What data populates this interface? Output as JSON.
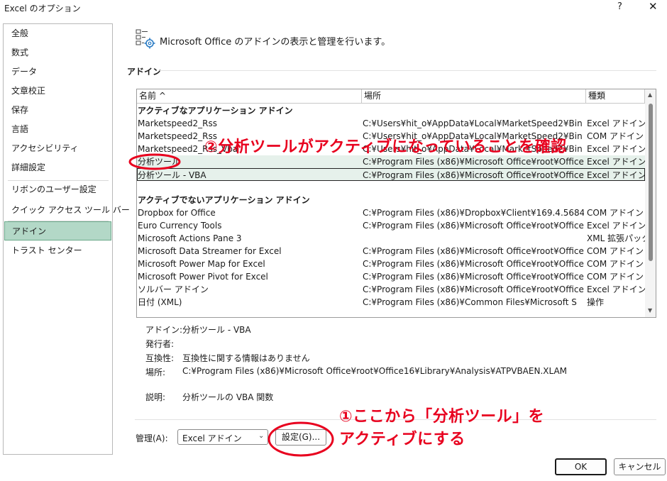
{
  "window": {
    "title": "Excel のオプション",
    "help": "?",
    "close": "✕"
  },
  "sidebar": {
    "items": [
      {
        "label": "全般"
      },
      {
        "label": "数式"
      },
      {
        "label": "データ"
      },
      {
        "label": "文章校正"
      },
      {
        "label": "保存"
      },
      {
        "label": "言語"
      },
      {
        "label": "アクセシビリティ"
      },
      {
        "label": "詳細設定"
      },
      {
        "label": "リボンのユーザー設定"
      },
      {
        "label": "クイック アクセス ツール バー"
      },
      {
        "label": "アドイン",
        "active": true
      },
      {
        "label": "トラスト センター"
      }
    ]
  },
  "header": {
    "text": "Microsoft Office のアドインの表示と管理を行います。",
    "icon": "addins-gear-icon"
  },
  "section": {
    "title": "アドイン"
  },
  "table": {
    "columns": [
      "名前 ^",
      "場所",
      "種類"
    ],
    "active_group": "アクティブなアプリケーション アドイン",
    "active_rows": [
      {
        "name": "Marketspeed2_Rss",
        "location": "C:¥Users¥hit_o¥AppData¥Local¥MarketSpeed2¥Bin",
        "type": "Excel アドイン"
      },
      {
        "name": "Marketspeed2_Rss",
        "location": "C:¥Users¥hit_o¥AppData¥Local¥MarketSpeed2¥Bin",
        "type": "COM アドイン"
      },
      {
        "name": "Marketspeed2_Rss_Vba",
        "location": "C:¥Users¥hit_o¥AppData¥Local¥MarketSpeed2¥Bin",
        "type": "Excel アドイン"
      },
      {
        "name": "分析ツール",
        "location": "C:¥Program Files (x86)¥Microsoft Office¥root¥Office",
        "type": "Excel アドイン"
      },
      {
        "name": "分析ツール - VBA",
        "location": "C:¥Program Files (x86)¥Microsoft Office¥root¥Office",
        "type": "Excel アドイン"
      }
    ],
    "inactive_group": "アクティブでないアプリケーション アドイン",
    "inactive_rows": [
      {
        "name": "Dropbox for Office",
        "location": "C:¥Program Files (x86)¥Dropbox¥Client¥169.4.5684",
        "type": "COM アドイン"
      },
      {
        "name": "Euro Currency Tools",
        "location": "C:¥Program Files (x86)¥Microsoft Office¥root¥Office",
        "type": "Excel アドイン"
      },
      {
        "name": "Microsoft Actions Pane 3",
        "location": "",
        "type": "XML 拡張パック"
      },
      {
        "name": "Microsoft Data Streamer for Excel",
        "location": "C:¥Program Files (x86)¥Microsoft Office¥root¥Office",
        "type": "COM アドイン"
      },
      {
        "name": "Microsoft Power Map for Excel",
        "location": "C:¥Program Files (x86)¥Microsoft Office¥root¥Office",
        "type": "COM アドイン"
      },
      {
        "name": "Microsoft Power Pivot for Excel",
        "location": "C:¥Program Files (x86)¥Microsoft Office¥root¥Office",
        "type": "COM アドイン"
      },
      {
        "name": "ソルバー アドイン",
        "location": "C:¥Program Files (x86)¥Microsoft Office¥root¥Office",
        "type": "Excel アドイン"
      },
      {
        "name": "日付 (XML)",
        "location": "C:¥Program Files (x86)¥Common Files¥Microsoft S",
        "type": "操作"
      }
    ]
  },
  "details": {
    "addin_label": "アドイン:",
    "addin_value": "分析ツール - VBA",
    "publisher_label": "発行者:",
    "publisher_value": "",
    "compat_label": "互換性:",
    "compat_value": "互換性に関する情報はありません",
    "location_label": "場所:",
    "location_value": "C:¥Program Files (x86)¥Microsoft Office¥root¥Office16¥Library¥Analysis¥ATPVBAEN.XLAM",
    "desc_label": "説明:",
    "desc_value": "分析ツールの VBA 関数"
  },
  "manage": {
    "label": "管理(A):",
    "selected": "Excel アドイン",
    "go_label": "設定(G)..."
  },
  "footer": {
    "ok_label": "OK",
    "cancel_label": "キャンセル"
  },
  "annotations": {
    "note2": "②分析ツールがアクティブになっていることを確認",
    "note1_line1": "①ここから「分析ツール」を",
    "note1_line2": "アクティブにする",
    "color": "#e8001e"
  }
}
